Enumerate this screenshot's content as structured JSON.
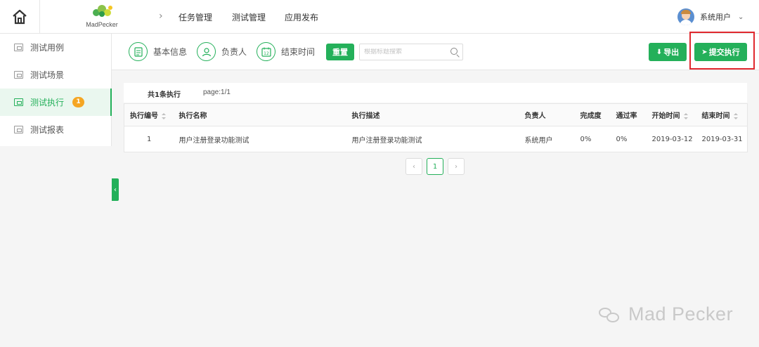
{
  "app": {
    "logo_text": "MadPecker"
  },
  "nav": {
    "items": [
      "任务管理",
      "测试管理",
      "应用发布"
    ]
  },
  "user": {
    "name": "系统用户"
  },
  "sidebar": {
    "items": [
      {
        "label": "测试用例",
        "icon": "code-icon"
      },
      {
        "label": "测试场景",
        "icon": "scene-icon"
      },
      {
        "label": "测试执行",
        "icon": "execute-icon",
        "badge": "1"
      },
      {
        "label": "测试报表",
        "icon": "report-icon"
      }
    ]
  },
  "toolbar": {
    "filters": [
      {
        "label": "基本信息",
        "icon": "document-icon"
      },
      {
        "label": "负责人",
        "icon": "person-icon"
      },
      {
        "label": "结束时间",
        "icon": "calendar-icon",
        "icon_text": "12"
      }
    ],
    "reset_label": "重置",
    "search_placeholder": "根据标题搜索",
    "export_label": "导出",
    "submit_label": "提交执行"
  },
  "list": {
    "count_label": "共1条执行",
    "page_label": "page:1/1",
    "columns": [
      "执行编号",
      "执行名称",
      "执行描述",
      "负责人",
      "完成度",
      "通过率",
      "开始时间",
      "结束时间"
    ],
    "rows": [
      [
        "1",
        "用户注册登录功能测试",
        "用户注册登录功能测试",
        "系统用户",
        "0%",
        "0%",
        "2019-03-12",
        "2019-03-31"
      ]
    ]
  },
  "pagination": {
    "current": "1",
    "prev": "‹",
    "next": "›"
  },
  "watermark": {
    "text": "Mad Pecker"
  },
  "colors": {
    "accent": "#24b05a",
    "badge": "#f5a623",
    "highlight_frame": "#e0282e"
  }
}
